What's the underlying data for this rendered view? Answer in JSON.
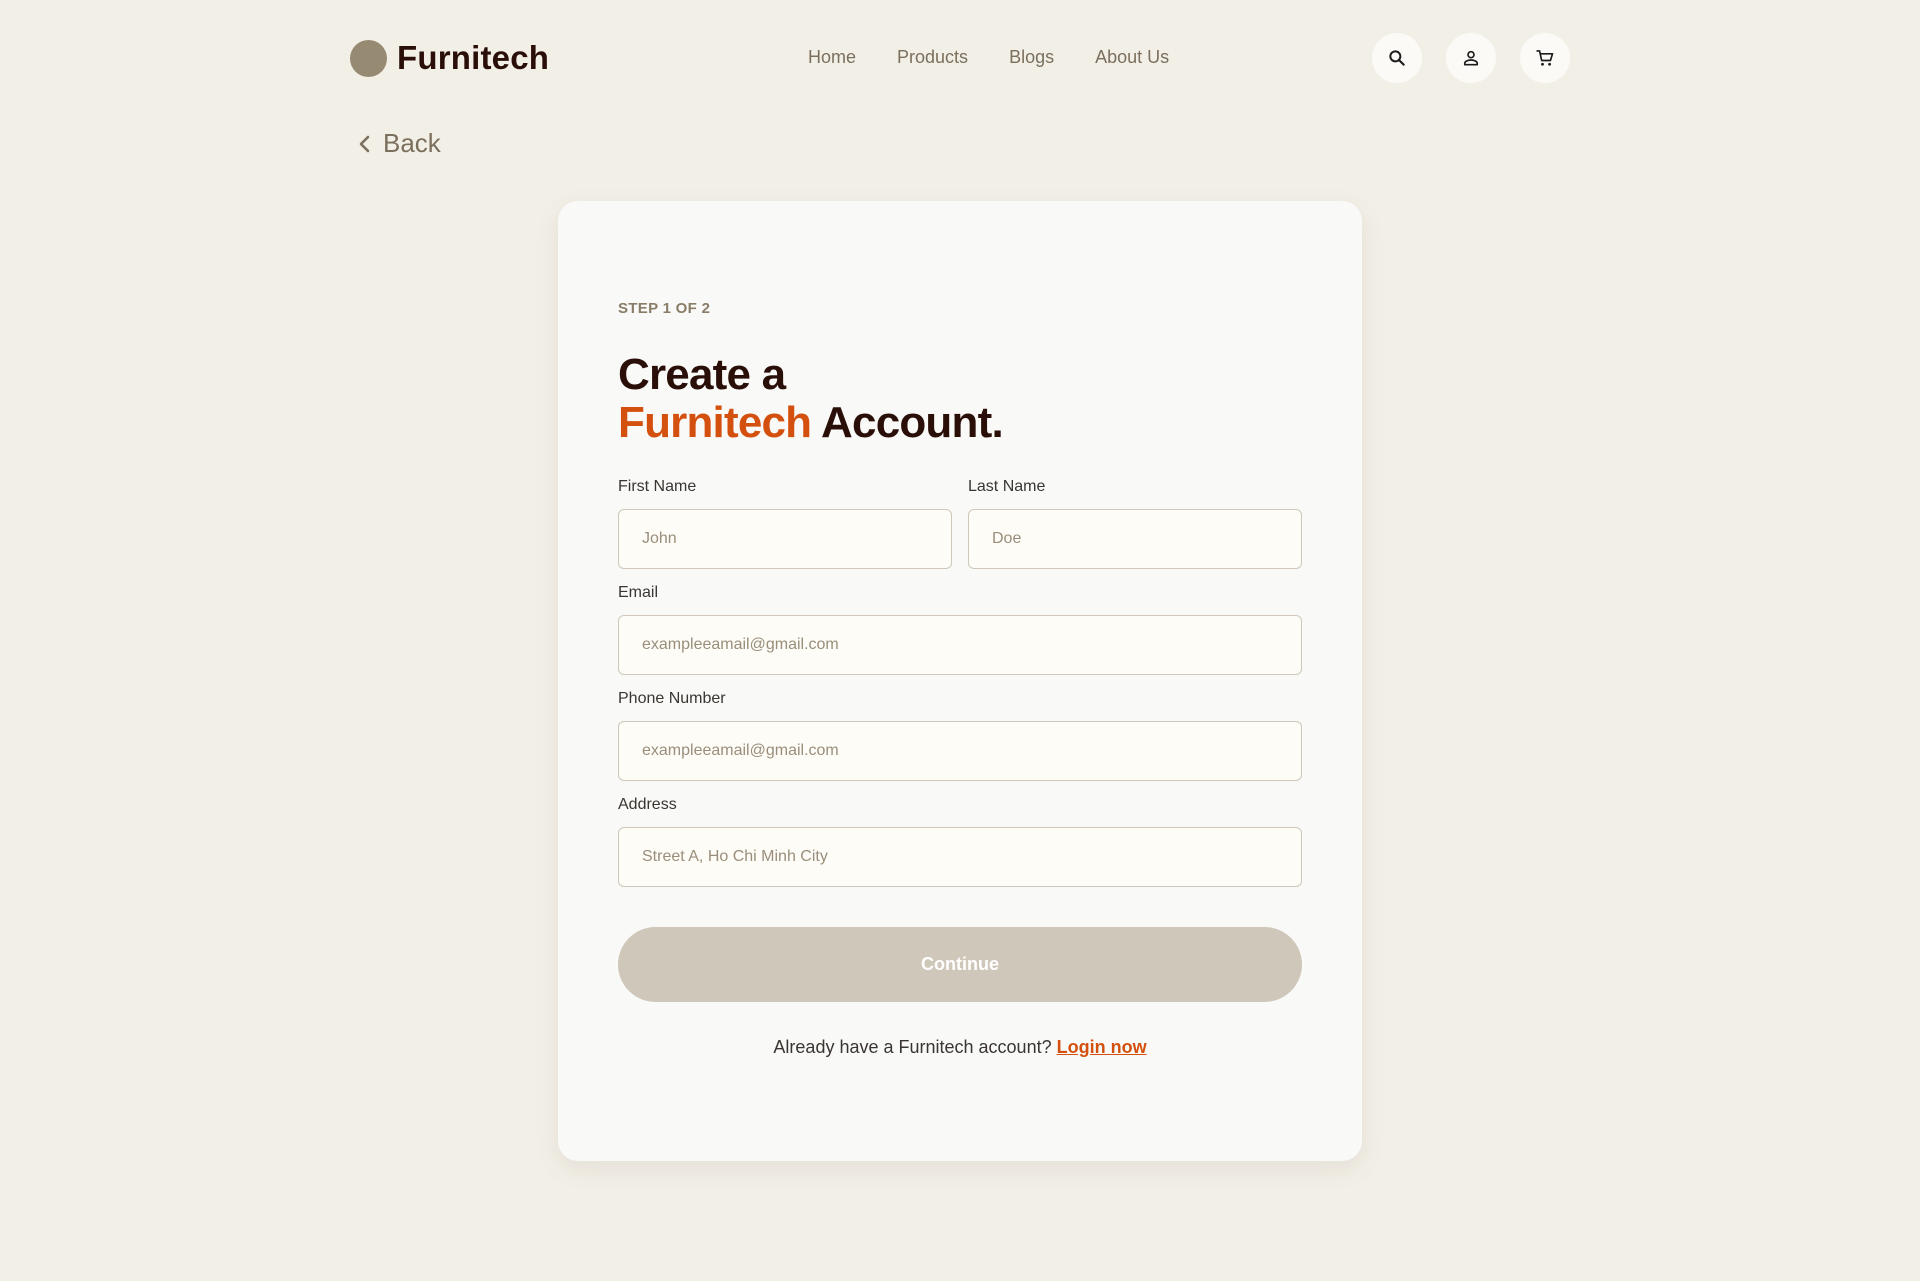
{
  "header": {
    "logo_text": "Furnitech",
    "nav": [
      "Home",
      "Products",
      "Blogs",
      "About Us"
    ],
    "icons": [
      "search-icon",
      "user-icon",
      "cart-icon"
    ]
  },
  "back": {
    "label": "Back"
  },
  "form": {
    "step": "STEP 1 OF 2",
    "title_line1": "Create a",
    "title_accent": "Furnitech",
    "title_rest": " Account.",
    "first_name": {
      "label": "First Name",
      "placeholder": "John"
    },
    "last_name": {
      "label": "Last Name",
      "placeholder": "Doe"
    },
    "email": {
      "label": "Email",
      "placeholder": "exampleeamail@gmail.com"
    },
    "phone": {
      "label": "Phone Number",
      "placeholder": "exampleeamail@gmail.com"
    },
    "address": {
      "label": "Address",
      "placeholder": "Street A, Ho Chi Minh City"
    },
    "continue_label": "Continue",
    "login_prompt": "Already have a Furnitech account? ",
    "login_link": "Login now"
  },
  "colors": {
    "background": "#f2efe7",
    "card": "#f9f9f8",
    "brand_dark": "#2a0f08",
    "accent": "#d4500e",
    "button_disabled": "#cfc7b9"
  }
}
